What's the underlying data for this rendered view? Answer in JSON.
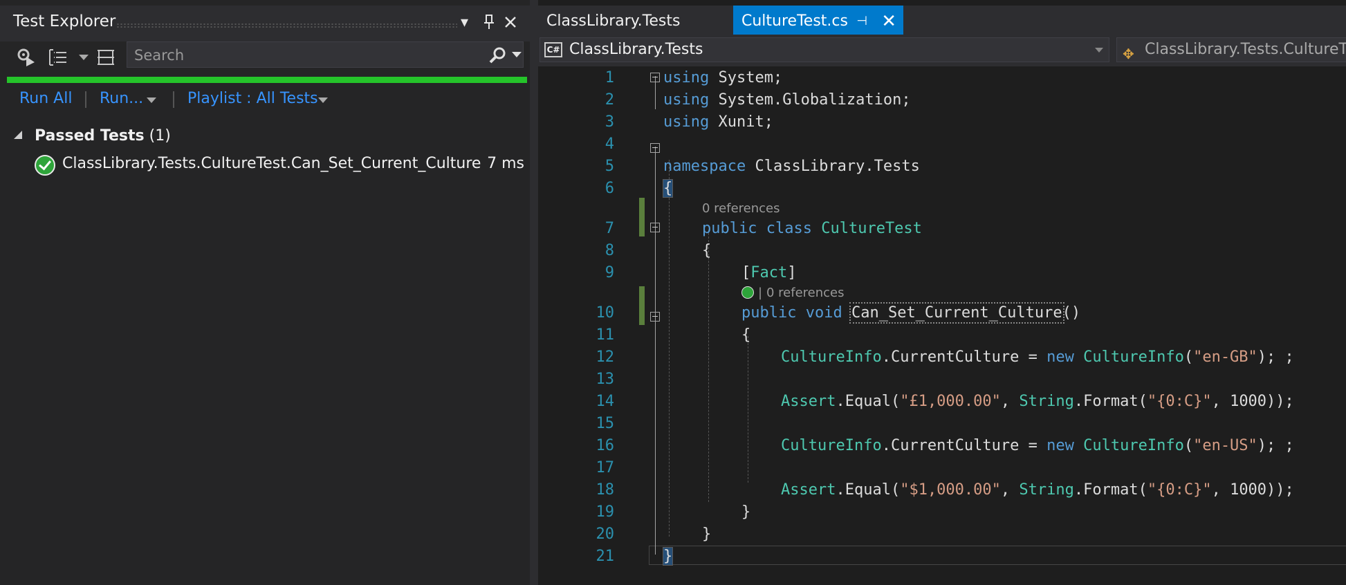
{
  "test_explorer": {
    "title": "Test Explorer",
    "search_placeholder": "Search",
    "run_all": "Run All",
    "run": "Run...",
    "playlist": "Playlist : All Tests",
    "group_label": "Passed Tests",
    "group_count": "(1)",
    "tests": [
      {
        "name": "ClassLibrary.Tests.CultureTest.Can_Set_Current_Culture",
        "duration": "7 ms",
        "status": "passed"
      }
    ],
    "progress_fraction": 1.0,
    "progress_color": "#25c42a"
  },
  "editor": {
    "tabs": [
      {
        "label": "ClassLibrary.Tests",
        "active": false
      },
      {
        "label": "CultureTest.cs",
        "active": true
      }
    ],
    "nav": {
      "project_badge": "C#",
      "project": "ClassLibrary.Tests",
      "type": "ClassLibrary.Tests.CultureTest"
    },
    "line_numbers": [
      "1",
      "2",
      "3",
      "4",
      "5",
      "6",
      "7",
      "8",
      "9",
      "10",
      "11",
      "12",
      "13",
      "14",
      "15",
      "16",
      "17",
      "18",
      "19",
      "20",
      "21"
    ],
    "codelens": {
      "class_refs": "0 references",
      "method_refs": "0 references",
      "separator": "|"
    },
    "code": {
      "l1_kw": "using",
      "l1_rest": " System;",
      "l2_kw": "using",
      "l2_rest": " System.Globalization;",
      "l3_kw": "using",
      "l3_rest": " Xunit;",
      "l5_kw": "namespace",
      "l5_rest": " ClassLibrary.Tests",
      "l6": "{",
      "l7_kw1": "public",
      "l7_kw2": "class",
      "l7_type": "CultureTest",
      "l8": "{",
      "l9_open": "[",
      "l9_attr": "Fact",
      "l9_close": "]",
      "l10_kw1": "public",
      "l10_kw2": "void",
      "l10_name": "Can_Set_Current_Culture",
      "l10_rest": "()",
      "l11": "{",
      "l12_t1": "CultureInfo",
      "l12_p1": ".CurrentCulture = ",
      "l12_kw": "new",
      "l12_t2": "CultureInfo",
      "l12_p2": "(",
      "l12_s": "\"en-GB\"",
      "l12_p3": "); ;",
      "l14_t1": "Assert",
      "l14_p1": ".Equal(",
      "l14_s1": "\"£1,000.00\"",
      "l14_p2": ", ",
      "l14_t2": "String",
      "l14_p3": ".Format(",
      "l14_s2": "\"{0:C}\"",
      "l14_p4": ", 1000));",
      "l16_t1": "CultureInfo",
      "l16_p1": ".CurrentCulture = ",
      "l16_kw": "new",
      "l16_t2": "CultureInfo",
      "l16_p2": "(",
      "l16_s": "\"en-US\"",
      "l16_p3": "); ;",
      "l18_t1": "Assert",
      "l18_p1": ".Equal(",
      "l18_s1": "\"$1,000.00\"",
      "l18_p2": ", ",
      "l18_t2": "String",
      "l18_p3": ".Format(",
      "l18_s2": "\"{0:C}\"",
      "l18_p4": ", 1000));",
      "l19": "}",
      "l20": "}",
      "l21": "}"
    },
    "colors": {
      "keyword": "#569cd6",
      "type": "#4ec9b0",
      "string": "#d69d85",
      "line_number": "#2b91af",
      "accent": "#007acc"
    }
  }
}
